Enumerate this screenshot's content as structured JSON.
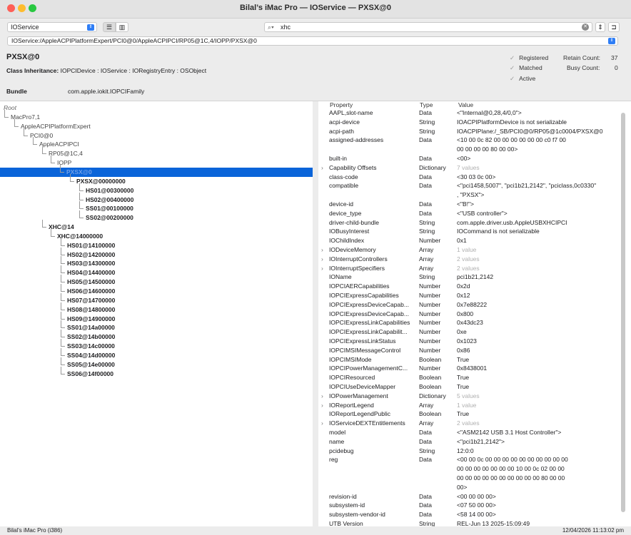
{
  "window": {
    "title": "Bilal’s iMac Pro — IOService — PXSX@0"
  },
  "toolbar": {
    "plane": "IOService",
    "search_value": "xhc"
  },
  "path": "IOService:/AppleACPIPlatformExpert/PCI0@0/AppleACPIPCI/RP05@1C,4/IOPP/PXSX@0",
  "header": {
    "object_name": "PXSX@0",
    "inheritance_label": "Class Inheritance:",
    "inheritance": "IOPCIDevice : IOService : IORegistryEntry : OSObject",
    "bundle_label": "Bundle",
    "bundle": "com.apple.iokit.IOPCIFamily",
    "registered": "Registered",
    "matched": "Matched",
    "active": "Active",
    "retain_label": "Retain Count:",
    "retain": "37",
    "busy_label": "Busy Count:",
    "busy": "0"
  },
  "tree": [
    {
      "label": "Root",
      "italic": true
    },
    {
      "label": "MacPro7,1"
    },
    {
      "label": "AppleACPIPlatformExpert"
    },
    {
      "label": "PCI0@0"
    },
    {
      "label": "AppleACPIPCI"
    },
    {
      "label": "RP05@1C,4"
    },
    {
      "label": "IOPP"
    },
    {
      "label": "PXSX@0"
    },
    {
      "label": "PXSX@00000000"
    },
    {
      "label": "HS01@00300000"
    },
    {
      "label": "HS02@00400000"
    },
    {
      "label": "SS01@00100000"
    },
    {
      "label": "SS02@00200000"
    },
    {
      "label": "XHC@14"
    },
    {
      "label": "XHC@14000000"
    },
    {
      "label": "HS01@14100000"
    },
    {
      "label": "HS02@14200000"
    },
    {
      "label": "HS03@14300000"
    },
    {
      "label": "HS04@14400000"
    },
    {
      "label": "HS05@14500000"
    },
    {
      "label": "HS06@14600000"
    },
    {
      "label": "HS07@14700000"
    },
    {
      "label": "HS08@14800000"
    },
    {
      "label": "HS09@14900000"
    },
    {
      "label": "SS01@14a00000"
    },
    {
      "label": "SS02@14b00000"
    },
    {
      "label": "SS03@14c00000"
    },
    {
      "label": "SS04@14d00000"
    },
    {
      "label": "SS05@14e00000"
    },
    {
      "label": "SS06@14f00000"
    }
  ],
  "props_header": {
    "property": "Property",
    "type": "Type",
    "value": "Value"
  },
  "props": [
    {
      "p": "AAPL,slot-name",
      "t": "Data",
      "v": "<\"Internal@0,28,4/0,0\">"
    },
    {
      "p": "acpi-device",
      "t": "String",
      "v": "IOACPIPlatformDevice is not serializable"
    },
    {
      "p": "acpi-path",
      "t": "String",
      "v": "IOACPIPlane:/_SB/PCI0@0/RP05@1c0004/PXSX@0"
    },
    {
      "p": "assigned-addresses",
      "t": "Data",
      "v": "<10 00 0c 82 00 00 00 00 00 00 c0 f7 00",
      "v2": "00 00 00 00 80 00 00>"
    },
    {
      "p": "built-in",
      "t": "Data",
      "v": "<00>"
    },
    {
      "p": "Capability Offsets",
      "t": "Dictionary",
      "v": "7 values",
      "exp": true,
      "g": true
    },
    {
      "p": "class-code",
      "t": "Data",
      "v": "<30 03 0c 00>"
    },
    {
      "p": "compatible",
      "t": "Data",
      "v": "<\"pci1458,5007\", \"pci1b21,2142\", \"pciclass,0c0330\"",
      "v2": ", \"PXSX\">"
    },
    {
      "p": "device-id",
      "t": "Data",
      "v": "<\"B!\">"
    },
    {
      "p": "device_type",
      "t": "Data",
      "v": "<\"USB controller\">"
    },
    {
      "p": "driver-child-bundle",
      "t": "String",
      "v": "com.apple.driver.usb.AppleUSBXHCIPCI"
    },
    {
      "p": "IOBusyInterest",
      "t": "String",
      "v": "IOCommand is not serializable"
    },
    {
      "p": "IOChildIndex",
      "t": "Number",
      "v": "0x1"
    },
    {
      "p": "IODeviceMemory",
      "t": "Array",
      "v": "1 value",
      "exp": true,
      "g": true
    },
    {
      "p": "IOInterruptControllers",
      "t": "Array",
      "v": "2 values",
      "exp": true,
      "g": true
    },
    {
      "p": "IOInterruptSpecifiers",
      "t": "Array",
      "v": "2 values",
      "exp": true,
      "g": true
    },
    {
      "p": "IOName",
      "t": "String",
      "v": "pci1b21,2142"
    },
    {
      "p": "IOPCIAERCapabilities",
      "t": "Number",
      "v": "0x2d"
    },
    {
      "p": "IOPCIExpressCapabilities",
      "t": "Number",
      "v": "0x12"
    },
    {
      "p": "IOPCIExpressDeviceCapab...",
      "t": "Number",
      "v": "0x7e88222"
    },
    {
      "p": "IOPCIExpressDeviceCapab...",
      "t": "Number",
      "v": "0x800"
    },
    {
      "p": "IOPCIExpressLinkCapabilities",
      "t": "Number",
      "v": "0x43dc23"
    },
    {
      "p": "IOPCIExpressLinkCapabilit...",
      "t": "Number",
      "v": "0xe"
    },
    {
      "p": "IOPCIExpressLinkStatus",
      "t": "Number",
      "v": "0x1023"
    },
    {
      "p": "IOPCIMSIMessageControl",
      "t": "Number",
      "v": "0x86"
    },
    {
      "p": "IOPCIMSIMode",
      "t": "Boolean",
      "v": "True"
    },
    {
      "p": "IOPCIPowerManagementC...",
      "t": "Number",
      "v": "0x8438001"
    },
    {
      "p": "IOPCIResourced",
      "t": "Boolean",
      "v": "True"
    },
    {
      "p": "IOPCIUseDeviceMapper",
      "t": "Boolean",
      "v": "True"
    },
    {
      "p": "IOPowerManagement",
      "t": "Dictionary",
      "v": "5 values",
      "exp": true,
      "g": true
    },
    {
      "p": "IOReportLegend",
      "t": "Array",
      "v": "1 value",
      "exp": true,
      "g": true
    },
    {
      "p": "IOReportLegendPublic",
      "t": "Boolean",
      "v": "True"
    },
    {
      "p": "IOServiceDEXTEntitlements",
      "t": "Array",
      "v": "2 values",
      "exp": true,
      "g": true
    },
    {
      "p": "model",
      "t": "Data",
      "v": "<\"ASM2142 USB 3.1 Host Controller\">"
    },
    {
      "p": "name",
      "t": "Data",
      "v": "<\"pci1b21,2142\">"
    },
    {
      "p": "pcidebug",
      "t": "String",
      "v": "12:0:0"
    },
    {
      "p": "reg",
      "t": "Data",
      "v": "<00 00 0c 00 00 00 00 00 00 00 00 00 00",
      "v2": "00 00 00 00 00 00 00 10 00 0c 02 00 00",
      "v3": "00 00 00 00 00 00 00 00 00 00 80 00 00",
      "v4": "00>"
    },
    {
      "p": "revision-id",
      "t": "Data",
      "v": "<00 00 00 00>"
    },
    {
      "p": "subsystem-id",
      "t": "Data",
      "v": "<07 50 00 00>"
    },
    {
      "p": "subsystem-vendor-id",
      "t": "Data",
      "v": "<58 14 00 00>"
    },
    {
      "p": "UTB Version",
      "t": "String",
      "v": "REL-Jun 13 2025-15:09:49"
    }
  ],
  "status": {
    "left": "Bilal’s iMac Pro (i386)",
    "right": "12/04/2026 11:13:02 pm"
  }
}
